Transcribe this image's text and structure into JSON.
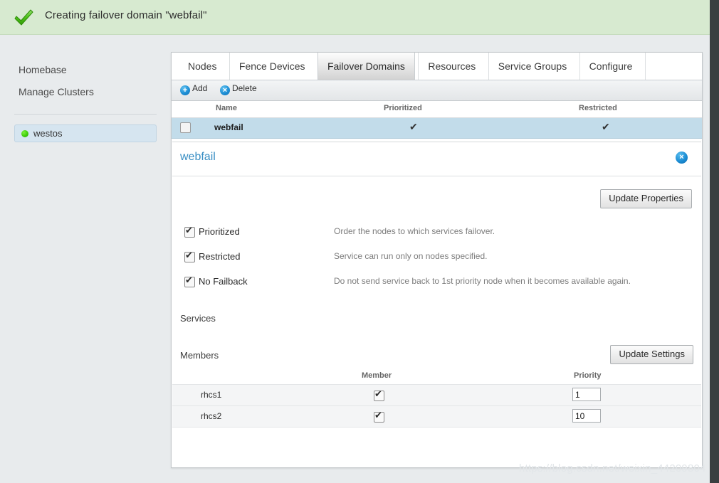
{
  "banner": {
    "icon": "green-check-icon",
    "text": "Creating failover domain \"webfail\""
  },
  "sidebar": {
    "links": [
      {
        "label": "Homebase"
      },
      {
        "label": "Manage Clusters"
      }
    ],
    "clusters": [
      {
        "label": "westos",
        "status_color": "#3fce09"
      }
    ]
  },
  "tabs": [
    {
      "label": "Nodes",
      "active": false
    },
    {
      "label": "Fence Devices",
      "active": false
    },
    {
      "label": "Failover Domains",
      "active": true
    },
    {
      "label": "Resources",
      "active": false
    },
    {
      "label": "Service Groups",
      "active": false
    },
    {
      "label": "Configure",
      "active": false
    }
  ],
  "toolbar": {
    "add_label": "Add",
    "add_glyph": "+",
    "delete_label": "Delete",
    "delete_glyph": "×"
  },
  "domains_table": {
    "headers": {
      "name": "Name",
      "prioritized": "Prioritized",
      "restricted": "Restricted"
    },
    "rows": [
      {
        "selected": false,
        "name": "webfail",
        "prioritized": "✔",
        "restricted": "✔"
      }
    ]
  },
  "detail": {
    "title": "webfail",
    "close_glyph": "×",
    "update_properties_label": "Update Properties",
    "properties": [
      {
        "label": "Prioritized",
        "checked": true,
        "description": "Order the nodes to which services failover."
      },
      {
        "label": "Restricted",
        "checked": true,
        "description": "Service can run only on nodes specified."
      },
      {
        "label": "No Failback",
        "checked": true,
        "description": "Do not send service back to 1st priority node when it becomes available again."
      }
    ],
    "services_label": "Services",
    "members_label": "Members",
    "update_settings_label": "Update Settings",
    "members_table": {
      "headers": {
        "member": "Member",
        "priority": "Priority"
      },
      "rows": [
        {
          "name": "rhcs1",
          "member_checked": true,
          "priority": "1"
        },
        {
          "name": "rhcs2",
          "member_checked": true,
          "priority": "10"
        }
      ]
    }
  },
  "watermark": "https://blog.csdn.net/weixin_44209804",
  "colors": {
    "banner_bg": "#d7ead0",
    "accent_blue": "#1b8dd4",
    "link_blue": "#3a8fc4",
    "row_highlight": "#c2dcea",
    "page_bg": "#e8ebed"
  }
}
